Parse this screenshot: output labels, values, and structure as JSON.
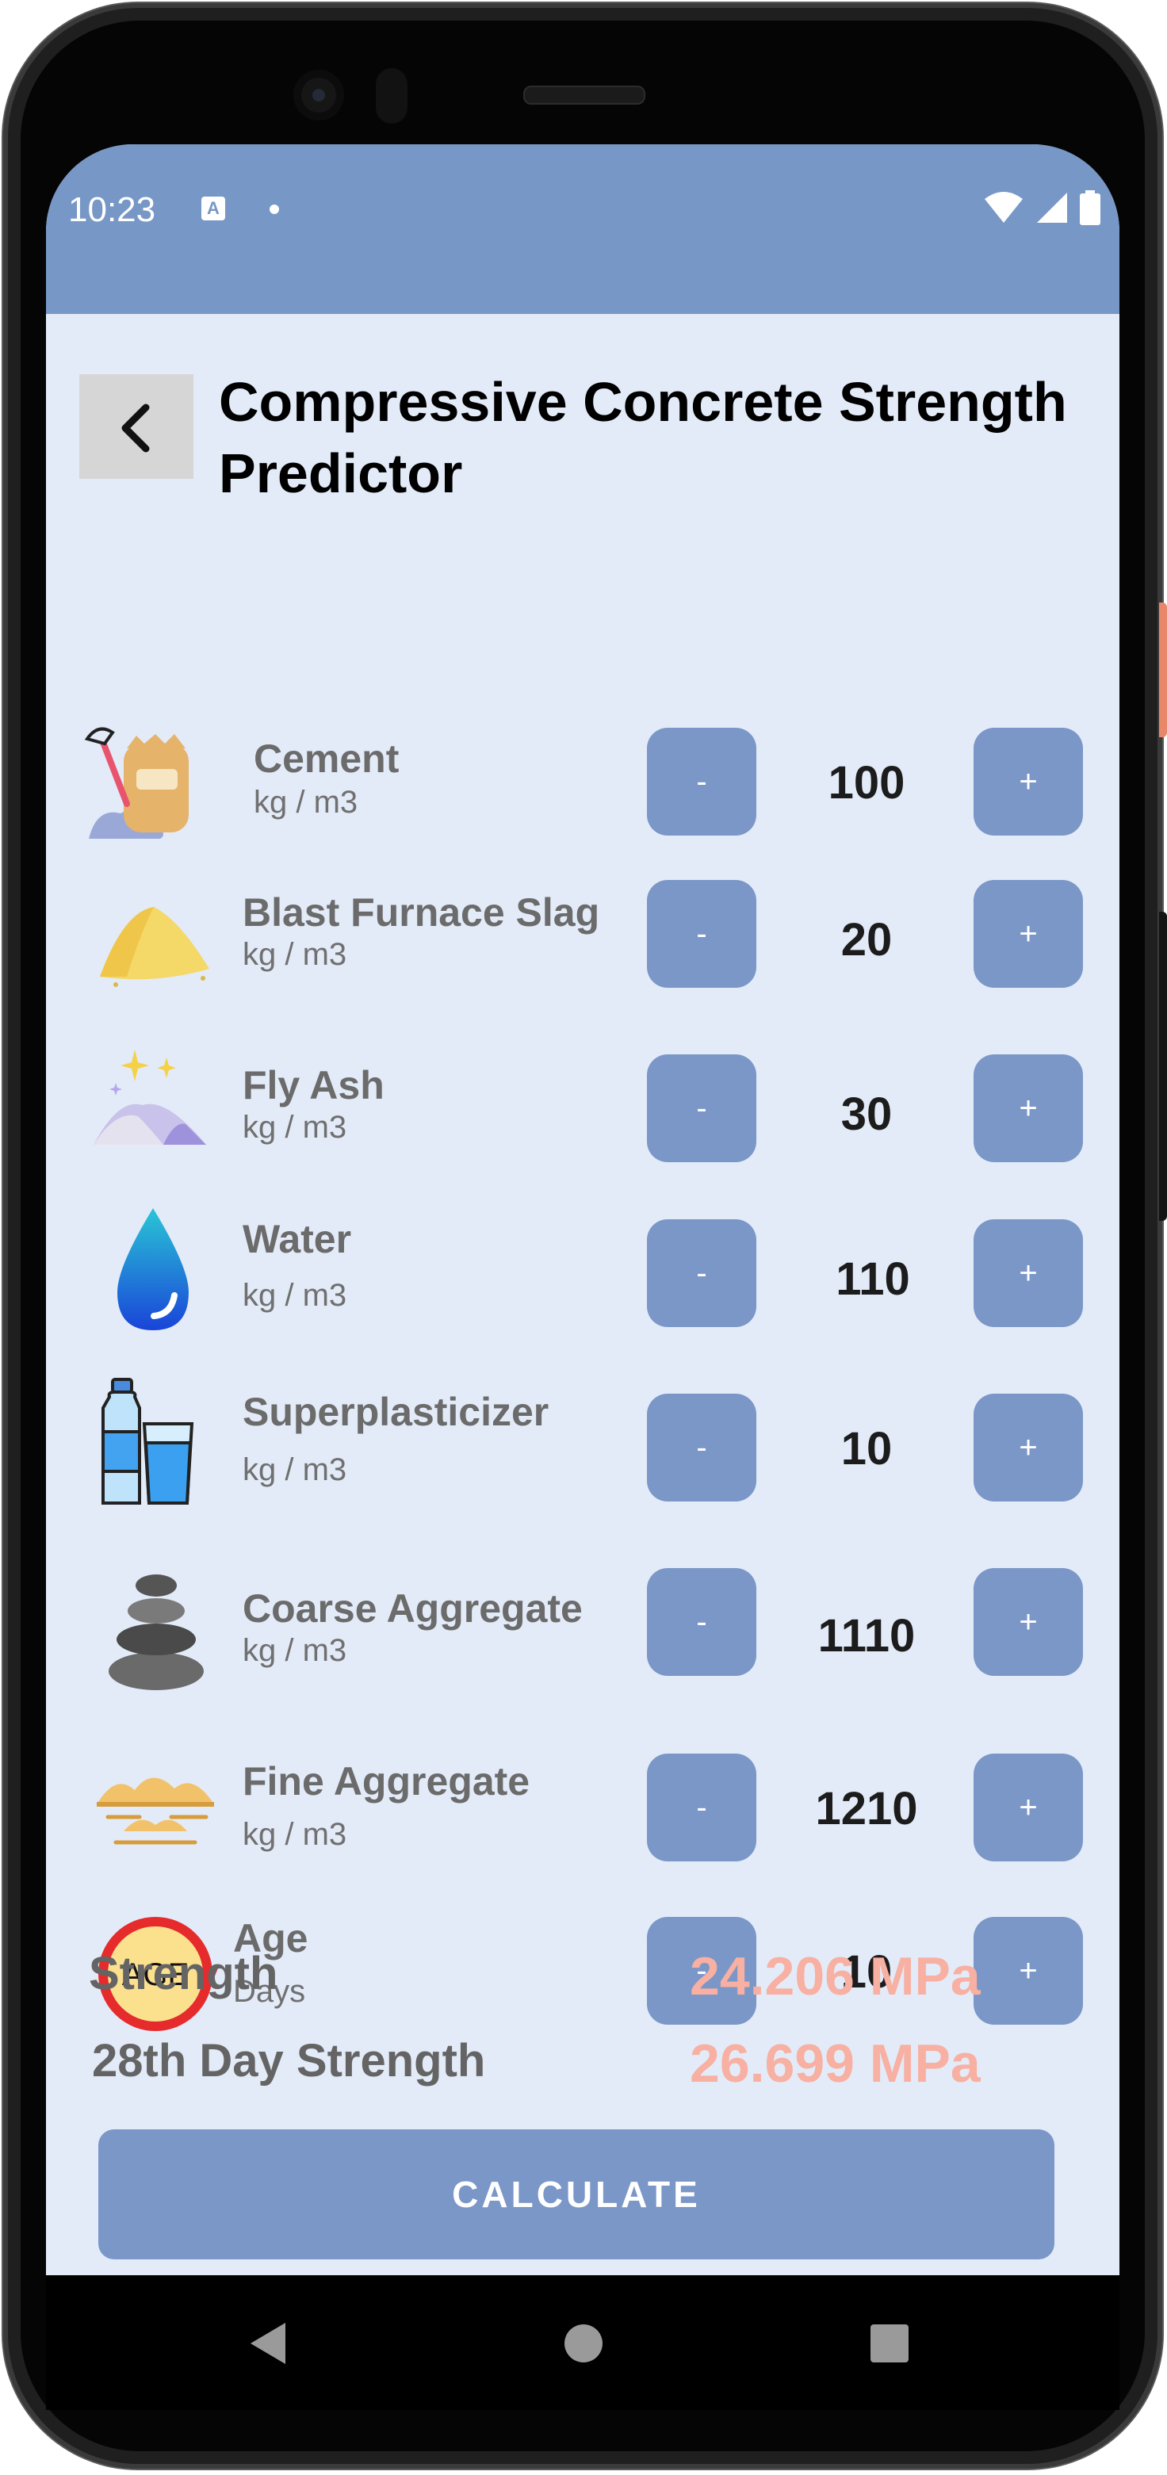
{
  "status_bar": {
    "time": "10:23",
    "notification_icon": "A",
    "icons": [
      "wifi-icon",
      "signal-icon",
      "battery-icon"
    ]
  },
  "header": {
    "back_icon": "chevron-left-icon",
    "title": "Compressive Concrete Strength Predictor"
  },
  "stepper": {
    "minus_label": "-",
    "plus_label": "+"
  },
  "ingredients": [
    {
      "name": "Cement",
      "unit": "kg / m3",
      "value": "100",
      "icon": "cement-bag-icon"
    },
    {
      "name": "Blast Furnace Slag",
      "unit": "kg / m3",
      "value": "20",
      "icon": "slag-pile-icon"
    },
    {
      "name": "Fly Ash",
      "unit": "kg / m3",
      "value": "30",
      "icon": "fly-ash-icon"
    },
    {
      "name": "Water",
      "unit": "kg / m3",
      "value": "110",
      "icon": "water-drop-icon"
    },
    {
      "name": "Superplasticizer",
      "unit": "kg / m3",
      "value": "10",
      "icon": "bottle-glass-icon"
    },
    {
      "name": "Coarse Aggregate",
      "unit": "kg / m3",
      "value": "1110",
      "icon": "stones-icon"
    },
    {
      "name": "Fine Aggregate",
      "unit": "kg / m3",
      "value": "1210",
      "icon": "sand-icon"
    },
    {
      "name": "Age",
      "unit": "Days",
      "value": "10",
      "icon": "age-icon"
    }
  ],
  "results": {
    "strength_label": "Strength",
    "strength_value": "24.206 MPa",
    "day28_label": "28th Day Strength",
    "day28_value": "26.699 MPa"
  },
  "calculate_label": "CALCULATE",
  "colors": {
    "primary": "#7b97c8",
    "background": "#e3ebf8",
    "result": "#f7b0a2",
    "status_bar": "#7797c7"
  }
}
